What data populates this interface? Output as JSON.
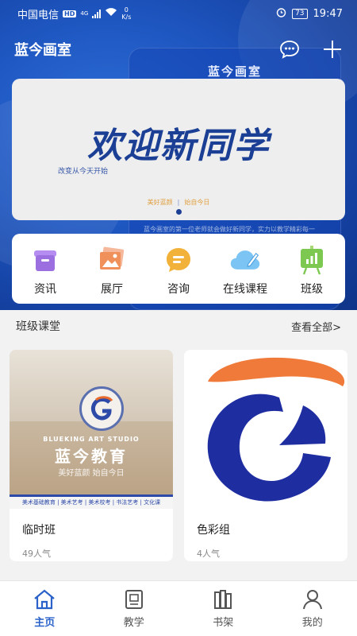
{
  "status_bar": {
    "carrier": "中国电信",
    "hd": "HD",
    "network": "4G",
    "net_speed_value": "0",
    "net_speed_unit": "K/s",
    "battery": "73",
    "time": "19:47"
  },
  "app": {
    "title": "蓝今画室"
  },
  "poster": {
    "title": "蓝今画室",
    "text": "蓝今画室的第一位老师就会做好新同学，实力以教学精彩每一"
  },
  "banner": {
    "main_text": "欢迎新同学",
    "sub_text": "改变从今天开始",
    "foot_left": "美好蓝颜",
    "foot_right": "始自今日",
    "slide_count": 1,
    "active_slide": 1
  },
  "quick_menu": [
    {
      "label": "资讯",
      "icon": "news-box-icon",
      "color": "#9b6fe0"
    },
    {
      "label": "展厅",
      "icon": "gallery-icon",
      "color": "#f0905a"
    },
    {
      "label": "咨询",
      "icon": "chat-bubble-icon",
      "color": "#f2b23a"
    },
    {
      "label": "在线课程",
      "icon": "cloud-pen-icon",
      "color": "#68b8f0"
    },
    {
      "label": "班级",
      "icon": "class-board-icon",
      "color": "#7cc850"
    }
  ],
  "section": {
    "title": "班级课堂",
    "more": "查看全部>"
  },
  "cards": [
    {
      "name": "临时班",
      "popularity": "49人气",
      "image": {
        "en_text": "BLUEKING ART STUDIO",
        "cn_text": "蓝今教育",
        "slogan": "美好蓝颜 始自今日",
        "strip": "美术基础教育 | 美术艺考 | 美术校考 | 书法艺考 | 文化课"
      }
    },
    {
      "name": "色彩组",
      "popularity": "4人气",
      "image": {
        "logo": "blueking-logo-icon"
      }
    }
  ],
  "tabs": [
    {
      "label": "主页",
      "icon": "home-icon",
      "active": true
    },
    {
      "label": "教学",
      "icon": "teaching-icon",
      "active": false
    },
    {
      "label": "书架",
      "icon": "bookshelf-icon",
      "active": false
    },
    {
      "label": "我的",
      "icon": "profile-icon",
      "active": false
    }
  ],
  "colors": {
    "brand_blue": "#1e56c0",
    "active_tab": "#2a62c9"
  }
}
